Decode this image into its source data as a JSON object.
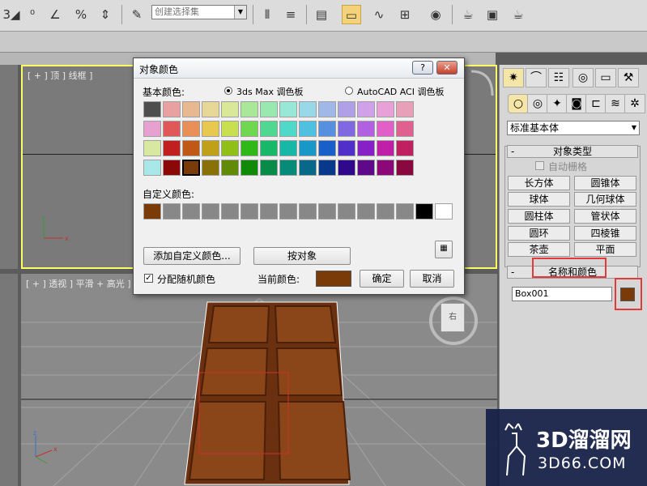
{
  "toolbar": {
    "selection_set_placeholder": "创建选择集",
    "snap_number": "3"
  },
  "viewports": {
    "top_label": "[ + ] 顶 ] 线框 ]",
    "persp_label": "[ + ] 透视 ] 平滑 + 高光 ]",
    "viewcube_label": "右"
  },
  "dialog": {
    "title": "对象颜色",
    "help_button": "?",
    "close_button": "✕",
    "basic_colors_label": "基本颜色:",
    "palette_3dsmax": "3ds Max 调色板",
    "palette_autocad": "AutoCAD ACI 调色板",
    "custom_colors_label": "自定义颜色:",
    "add_custom_button": "添加自定义颜色...",
    "by_object_button": "按对象",
    "random_colors_label": "分配随机颜色",
    "current_color_label": "当前颜色:",
    "ok_button": "确定",
    "cancel_button": "取消",
    "current_color": "#7a3b08",
    "basic_colors": [
      [
        "#4e4e4e",
        "#e8a0a0",
        "#e8b890",
        "#e8d898",
        "#d8e898",
        "#a8e898",
        "#98e8b0",
        "#98e8d8",
        "#98d8e8",
        "#a0b8e8",
        "#b0a0e8",
        "#d0a0e8",
        "#e8a0d8",
        "#e8a0b8"
      ],
      [
        "#e8a0d0",
        "#e05858",
        "#e89058",
        "#e8c850",
        "#c8e050",
        "#70d850",
        "#50d890",
        "#50d8c8",
        "#50c0e0",
        "#5890e0",
        "#8068e0",
        "#b060e0",
        "#e060c8",
        "#e06090"
      ],
      [
        "#d8e8a0",
        "#c02020",
        "#c05818",
        "#c0a018",
        "#90c018",
        "#30b818",
        "#18b868",
        "#18b8a8",
        "#1898c8",
        "#1860c8",
        "#5030c8",
        "#8820c8",
        "#c020a8",
        "#c02060"
      ],
      [
        "#a8e8e8",
        "#8a0808",
        "#7a3b08",
        "#8a7008",
        "#608a08",
        "#108a08",
        "#088a48",
        "#088a78",
        "#08688a",
        "#08388a",
        "#30088a",
        "#60088a",
        "#8a0878",
        "#8a0840"
      ]
    ],
    "selected_basic": [
      3,
      2
    ],
    "custom_colors": [
      "#7a3b08",
      "#888888",
      "#888888",
      "#888888",
      "#888888",
      "#888888",
      "#888888",
      "#888888",
      "#888888",
      "#888888",
      "#888888",
      "#888888",
      "#888888",
      "#888888",
      "#000000",
      "#ffffff"
    ]
  },
  "cmd_panel": {
    "category_dropdown": "标准基本体",
    "object_type_header": "对象类型",
    "autogrid_label": "自动栅格",
    "buttons": [
      "长方体",
      "圆锥体",
      "球体",
      "几何球体",
      "圆柱体",
      "管状体",
      "圆环",
      "四棱锥",
      "茶壶",
      "平面"
    ],
    "name_color_header": "名称和颜色",
    "object_name": "Box001",
    "object_color": "#7a3b08"
  },
  "watermark": {
    "logo_text": "3D溜溜网",
    "logo_url": "3D66.COM"
  }
}
